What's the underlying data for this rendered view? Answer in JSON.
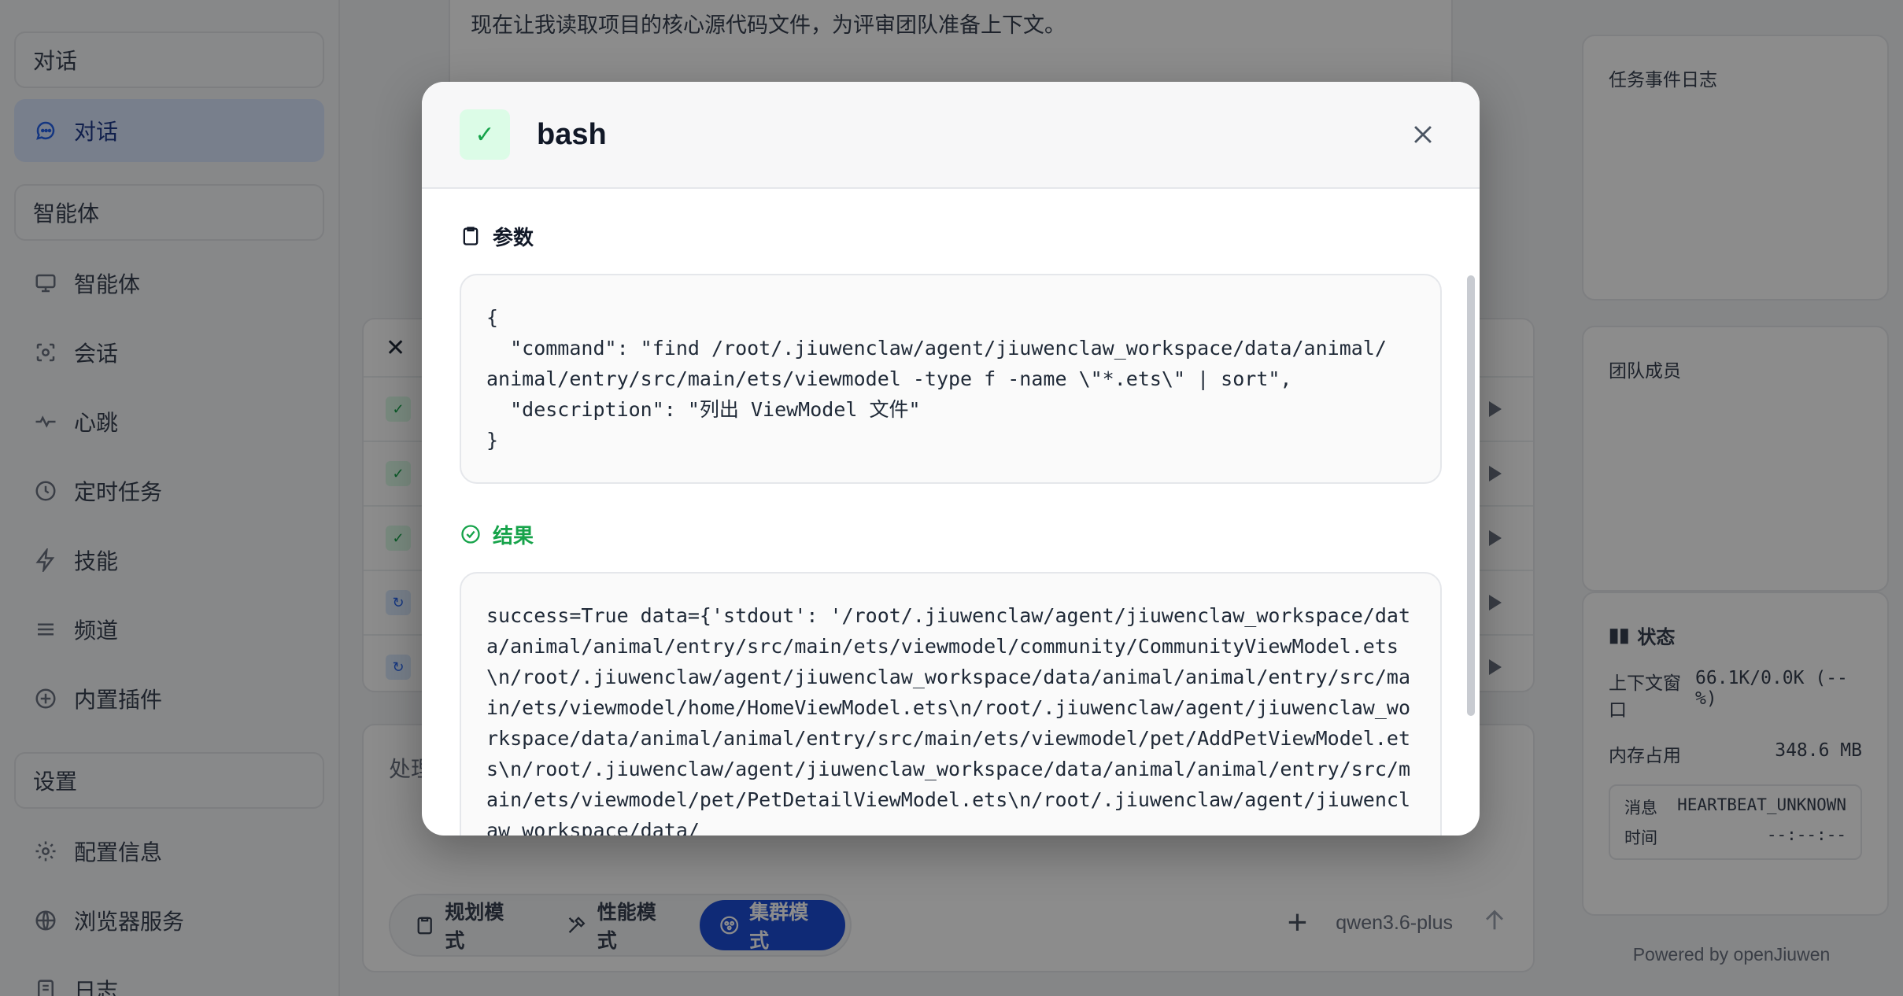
{
  "sidebar": {
    "section_chat": "对话",
    "chat_item": "对话",
    "section_agents": "智能体",
    "agent_items": [
      {
        "label": "智能体",
        "icon": "monitor-icon"
      },
      {
        "label": "会话",
        "icon": "session-icon"
      },
      {
        "label": "心跳",
        "icon": "heartbeat-icon"
      },
      {
        "label": "定时任务",
        "icon": "clock-icon"
      },
      {
        "label": "技能",
        "icon": "lightning-icon"
      },
      {
        "label": "频道",
        "icon": "menu-icon"
      },
      {
        "label": "内置插件",
        "icon": "plus-circle-icon"
      }
    ],
    "section_settings": "设置",
    "settings_items": [
      {
        "label": "配置信息",
        "icon": "gear-icon"
      },
      {
        "label": "浏览器服务",
        "icon": "globe-icon"
      },
      {
        "label": "日志",
        "icon": "log-icon"
      }
    ]
  },
  "main": {
    "message_text": "现在让我读取项目的核心源代码文件，为评审团队准备上下文。",
    "input_text": "处理",
    "modes": [
      {
        "label": "规划模式",
        "icon": "clipboard-icon",
        "active": false
      },
      {
        "label": "性能模式",
        "icon": "tools-icon",
        "active": false
      },
      {
        "label": "集群模式",
        "icon": "cluster-icon",
        "active": true
      }
    ],
    "model_name": "qwen3.6-plus"
  },
  "right": {
    "task_log_title": "任务事件日志",
    "team_title": "团队成员",
    "status_title": "状态",
    "context_label": "上下文窗口",
    "context_value": "66.1K/0.0K (--%)",
    "memory_label": "内存占用",
    "memory_value": "348.6 MB",
    "msg_label": "消息",
    "msg_value": "HEARTBEAT_UNKNOWN",
    "time_label": "时间",
    "time_value": "--:--:--",
    "powered_by": "Powered by openJiuwen"
  },
  "modal": {
    "title": "bash",
    "params_title": "参数",
    "params_json": "{\n  \"command\": \"find /root/.jiuwenclaw/agent/jiuwenclaw_workspace/data/animal/\nanimal/entry/src/main/ets/viewmodel -type f -name \\\"*.ets\\\" | sort\",\n  \"description\": \"列出 ViewModel 文件\"\n}",
    "result_title": "结果",
    "result_text": "success=True data={'stdout': '/root/.jiuwenclaw/agent/jiuwenclaw_workspace/data/animal/animal/entry/src/main/ets/viewmodel/community/CommunityViewModel.ets\\n/root/.jiuwenclaw/agent/jiuwenclaw_workspace/data/animal/animal/entry/src/main/ets/viewmodel/home/HomeViewModel.ets\\n/root/.jiuwenclaw/agent/jiuwenclaw_workspace/data/animal/animal/entry/src/main/ets/viewmodel/pet/AddPetViewModel.ets\\n/root/.jiuwenclaw/agent/jiuwenclaw_workspace/data/animal/animal/entry/src/main/ets/viewmodel/pet/PetDetailViewModel.ets\\n/root/.jiuwenclaw/agent/jiuwenclaw_workspace/data/"
  }
}
